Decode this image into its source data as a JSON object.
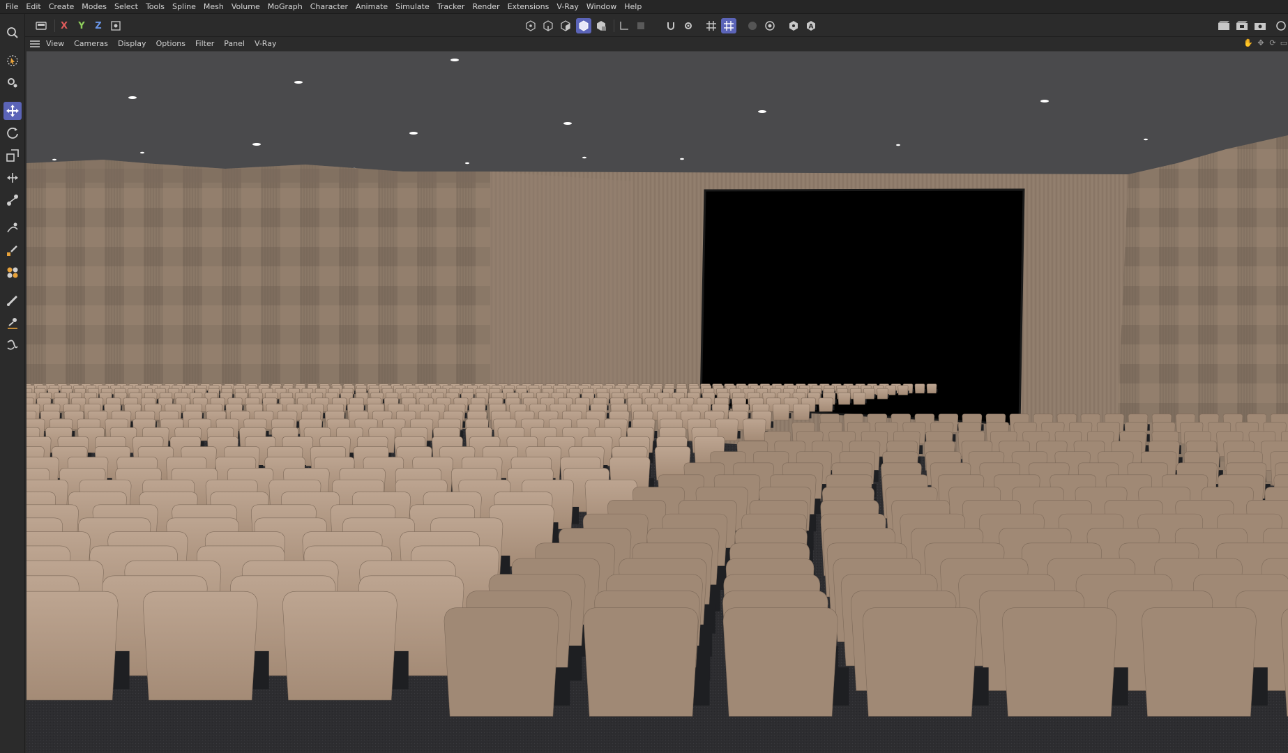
{
  "menu": [
    "File",
    "Edit",
    "Create",
    "Modes",
    "Select",
    "Tools",
    "Spline",
    "Mesh",
    "Volume",
    "MoGraph",
    "Character",
    "Animate",
    "Simulate",
    "Tracker",
    "Render",
    "Extensions",
    "V-Ray",
    "Window",
    "Help"
  ],
  "toolbar": {
    "axis_x": "X",
    "axis_y": "Y",
    "axis_z": "Z",
    "accent_color": "#5b64b8",
    "icons": [
      "undo-icon",
      "axis-lock-icon",
      "points-mode-icon",
      "edges-mode-icon",
      "polygons-mode-icon",
      "model-mode-icon",
      "texture-mode-icon",
      "workplane-icon",
      "snap-icon",
      "snap-settings-icon",
      "grid-icon",
      "quantize-icon",
      "render-view-icon",
      "render-settings-icon",
      "solo-icon",
      "auto-icon"
    ]
  },
  "viewport_menu": [
    "View",
    "Cameras",
    "Display",
    "Options",
    "Filter",
    "Panel",
    "V-Ray"
  ],
  "left_tools": [
    "live-selection-icon",
    "selection-settings-icon",
    "move-icon",
    "rotate-icon",
    "scale-icon",
    "transform-icon",
    "mograph-transform-icon",
    "spline-pen-icon",
    "spline-sketch-icon",
    "paint-icon",
    "brush-icon",
    "knife-icon",
    "twist-icon"
  ],
  "scene": {
    "description_colors": {
      "ceiling": "#4b4b4d",
      "wall": "#8a7868",
      "screen": "#000000",
      "seat": "#b39a85",
      "floor": "#2c2c2e"
    }
  }
}
